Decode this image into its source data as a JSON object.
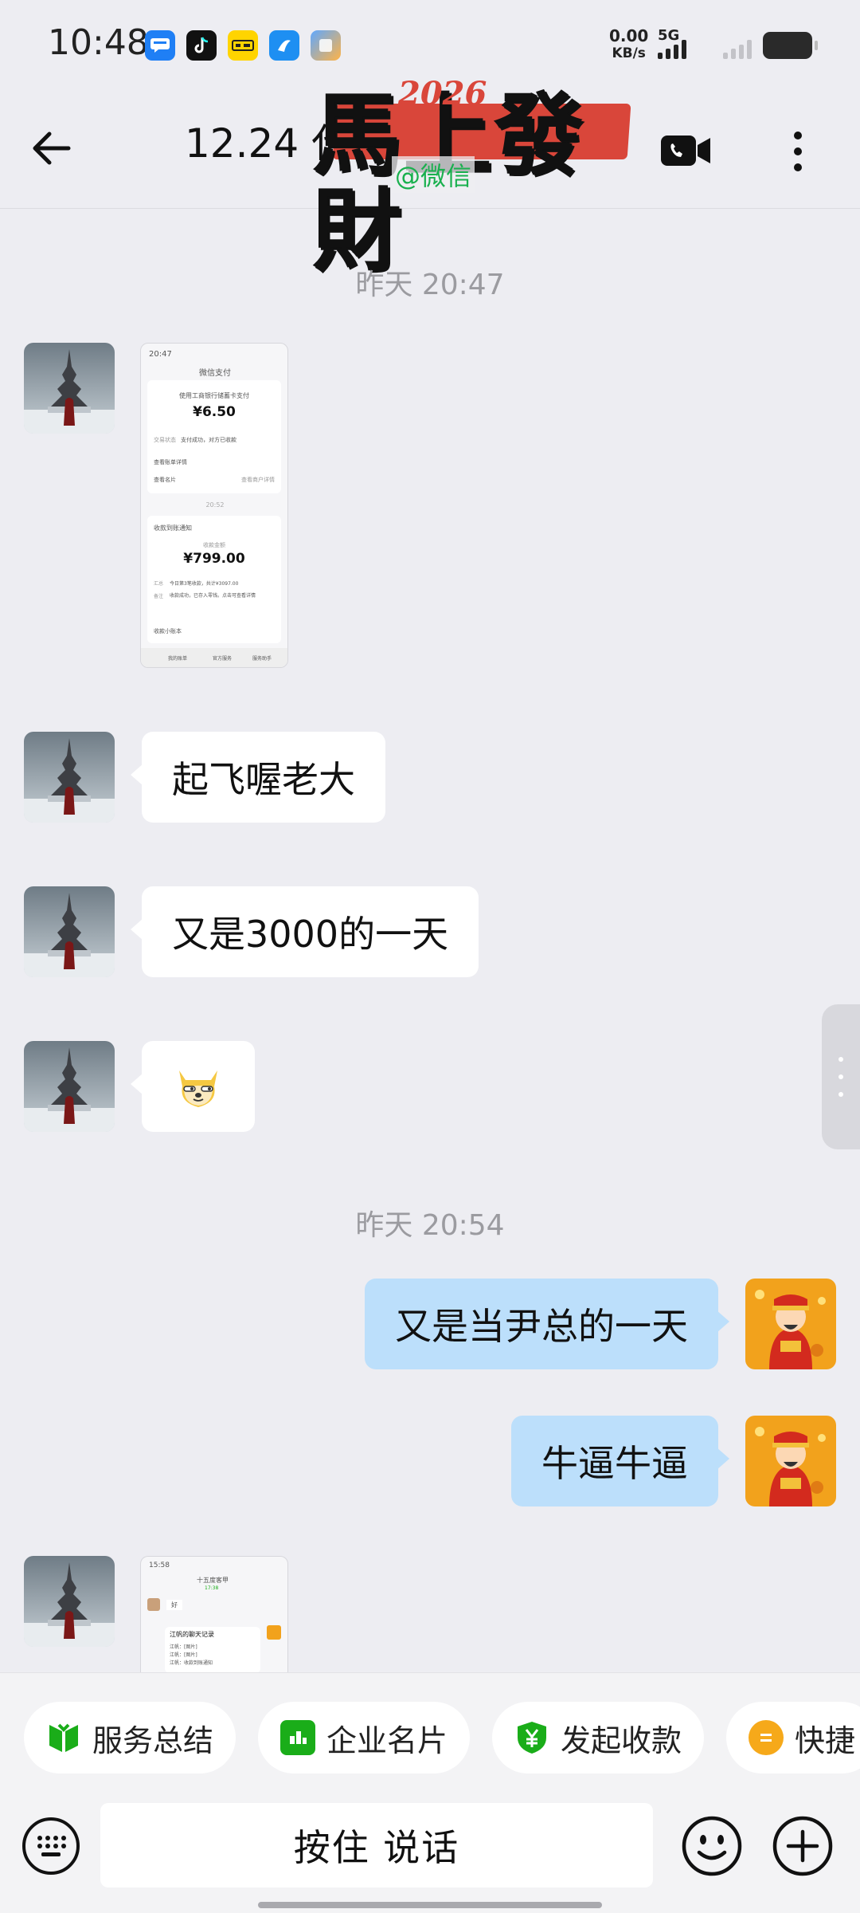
{
  "status_bar": {
    "time": "10:48",
    "net_speed_value": "0.00",
    "net_speed_unit": "KB/s",
    "network_type": "5G",
    "apps": [
      "message-app-icon",
      "tiktok-icon",
      "payment-app-icon",
      "browser-icon",
      "files-icon"
    ]
  },
  "header": {
    "title": "12.24 代",
    "banner_text": "馬上發財",
    "banner_year": "2026",
    "banner_handle": "@微信"
  },
  "messages": [
    {
      "type": "timestamp",
      "text": "昨天  20:47"
    },
    {
      "type": "image",
      "sender": "them",
      "shot": {
        "status_time": "20:47",
        "page_title": "微信支付",
        "card1_label": "使用工商银行储蓄卡支付",
        "card1_amount": "¥6.50",
        "card1_status_label": "交易状态",
        "card1_status": "支付成功，对方已收款",
        "card1_row1": "查看账单详情",
        "card1_row2": "查看名片",
        "card1_row2_value": "查看商户详情",
        "divider_time": "20:52",
        "card2_title": "收款到账通知",
        "card2_label": "收款金额",
        "card2_amount": "¥799.00",
        "card2_row1_label": "汇总",
        "card2_row1": "今日第3笔收款，共计¥3097.00",
        "card2_row2_label": "备注",
        "card2_row2": "收款成功，已存入零钱。点击可查看详情",
        "card2_footer": "收款小账本",
        "tab1": "我的账单",
        "tab2": "官方服务",
        "tab3": "服务助手"
      }
    },
    {
      "type": "text",
      "sender": "them",
      "text": "起飞喔老大"
    },
    {
      "type": "text",
      "sender": "them",
      "text": "又是3000的一天"
    },
    {
      "type": "emoji",
      "sender": "them",
      "emoji": "doge-emoji"
    },
    {
      "type": "timestamp",
      "text": "昨天  20:54"
    },
    {
      "type": "text",
      "sender": "me",
      "text": "又是当尹总的一天"
    },
    {
      "type": "text",
      "sender": "me",
      "text": "牛逼牛逼"
    },
    {
      "type": "image",
      "sender": "them",
      "shot": {
        "status_time": "15:58",
        "page_title": "十五度客甲",
        "page_subtitle": "17:38",
        "chat_line": "好",
        "card_title": "江帆的聊天记录",
        "card_line1": "江帆：[图片]",
        "card_line2": "江帆：[图片]",
        "card_line3": "江帆：收款到账通知"
      }
    }
  ],
  "quick_actions": [
    {
      "label": "服务总结",
      "icon": "bookmark-icon",
      "color": "#1aad19"
    },
    {
      "label": "企业名片",
      "icon": "card-icon",
      "color": "#1aad19"
    },
    {
      "label": "发起收款",
      "icon": "yuan-shield-icon",
      "color": "#1aad19"
    },
    {
      "label": "快捷",
      "icon": "quick-reply-icon",
      "color": "#f6a91a"
    }
  ],
  "input": {
    "hold_to_talk": "按住 说话"
  },
  "colors": {
    "background": "#ededf2",
    "my_bubble": "#bcdffb",
    "their_bubble": "#ffffff",
    "timestamp": "#9b9ba0",
    "accent_green": "#1aad19"
  }
}
